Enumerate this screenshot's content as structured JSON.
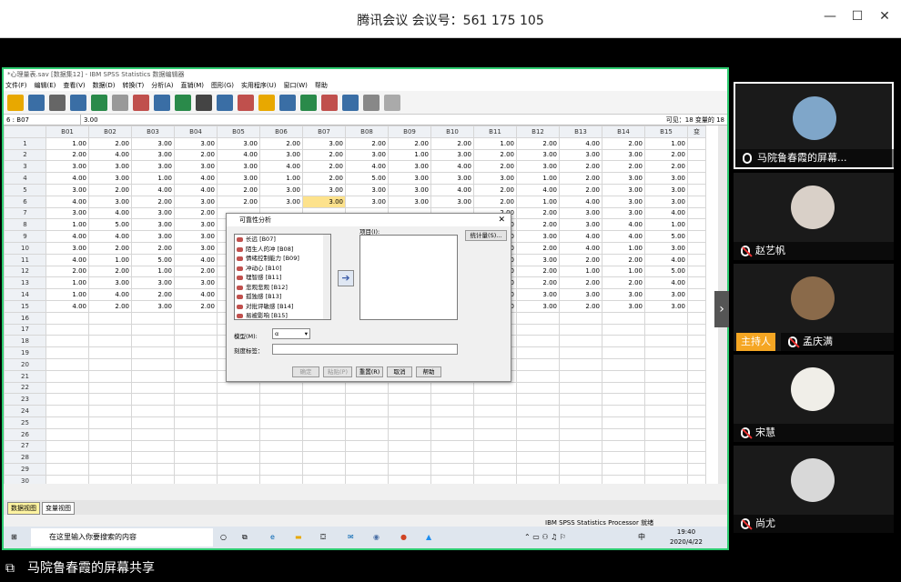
{
  "meeting": {
    "title": "腾讯会议 会议号：561 175 105"
  },
  "spss": {
    "title": "*心理量表.sav [数据集12] - IBM SPSS Statistics 数据编辑器",
    "menu": [
      "文件(F)",
      "编辑(E)",
      "查看(V)",
      "数据(D)",
      "转换(T)",
      "分析(A)",
      "直销(M)",
      "图形(G)",
      "实用程序(U)",
      "窗口(W)",
      "帮助"
    ],
    "cell_ref": "6 : B07",
    "cell_value": "3.00",
    "visible_label": "可见：18 变量的 18",
    "columns": [
      "B01",
      "B02",
      "B03",
      "B04",
      "B05",
      "B06",
      "B07",
      "B08",
      "B09",
      "B10",
      "B11",
      "B12",
      "B13",
      "B14",
      "B15",
      "变"
    ],
    "rows": [
      [
        "1.00",
        "2.00",
        "3.00",
        "3.00",
        "3.00",
        "2.00",
        "3.00",
        "2.00",
        "2.00",
        "2.00",
        "1.00",
        "2.00",
        "4.00",
        "2.00",
        "1.00"
      ],
      [
        "2.00",
        "4.00",
        "3.00",
        "2.00",
        "4.00",
        "3.00",
        "2.00",
        "3.00",
        "1.00",
        "3.00",
        "2.00",
        "3.00",
        "3.00",
        "3.00",
        "2.00"
      ],
      [
        "3.00",
        "3.00",
        "3.00",
        "3.00",
        "3.00",
        "4.00",
        "2.00",
        "4.00",
        "3.00",
        "4.00",
        "2.00",
        "3.00",
        "2.00",
        "2.00",
        "2.00"
      ],
      [
        "4.00",
        "3.00",
        "1.00",
        "4.00",
        "3.00",
        "1.00",
        "2.00",
        "5.00",
        "3.00",
        "3.00",
        "3.00",
        "1.00",
        "2.00",
        "3.00",
        "3.00"
      ],
      [
        "3.00",
        "2.00",
        "4.00",
        "4.00",
        "2.00",
        "3.00",
        "3.00",
        "3.00",
        "3.00",
        "4.00",
        "2.00",
        "4.00",
        "2.00",
        "3.00",
        "3.00"
      ],
      [
        "4.00",
        "3.00",
        "2.00",
        "3.00",
        "2.00",
        "3.00",
        "3.00",
        "3.00",
        "3.00",
        "3.00",
        "2.00",
        "1.00",
        "4.00",
        "3.00",
        "3.00"
      ],
      [
        "3.00",
        "4.00",
        "3.00",
        "2.00",
        "",
        "",
        "",
        "",
        "",
        "",
        "2.00",
        "2.00",
        "3.00",
        "3.00",
        "4.00"
      ],
      [
        "1.00",
        "5.00",
        "3.00",
        "3.00",
        "",
        "",
        "",
        "",
        "",
        "",
        "2.00",
        "2.00",
        "3.00",
        "4.00",
        "1.00"
      ],
      [
        "4.00",
        "4.00",
        "3.00",
        "3.00",
        "",
        "",
        "",
        "",
        "",
        "",
        "2.00",
        "3.00",
        "4.00",
        "4.00",
        "5.00"
      ],
      [
        "3.00",
        "2.00",
        "2.00",
        "3.00",
        "",
        "",
        "",
        "",
        "",
        "",
        "2.00",
        "2.00",
        "4.00",
        "1.00",
        "3.00"
      ],
      [
        "4.00",
        "1.00",
        "5.00",
        "4.00",
        "",
        "",
        "",
        "",
        "",
        "",
        "2.00",
        "3.00",
        "2.00",
        "2.00",
        "4.00"
      ],
      [
        "2.00",
        "2.00",
        "1.00",
        "2.00",
        "",
        "",
        "",
        "",
        "",
        "",
        "2.00",
        "2.00",
        "1.00",
        "1.00",
        "5.00"
      ],
      [
        "1.00",
        "3.00",
        "3.00",
        "3.00",
        "",
        "",
        "",
        "",
        "",
        "",
        "2.00",
        "2.00",
        "2.00",
        "2.00",
        "4.00"
      ],
      [
        "1.00",
        "4.00",
        "2.00",
        "4.00",
        "",
        "",
        "",
        "",
        "",
        "",
        "2.00",
        "3.00",
        "3.00",
        "3.00",
        "3.00"
      ],
      [
        "4.00",
        "2.00",
        "3.00",
        "2.00",
        "",
        "",
        "",
        "",
        "",
        "",
        "2.00",
        "3.00",
        "2.00",
        "3.00",
        "3.00"
      ]
    ],
    "row_numbers": [
      "1",
      "2",
      "3",
      "4",
      "5",
      "6",
      "7",
      "8",
      "9",
      "10",
      "11",
      "12",
      "13",
      "14",
      "15",
      "16",
      "17",
      "18",
      "19",
      "20",
      "21",
      "22",
      "23",
      "24",
      "25",
      "26",
      "27",
      "28",
      "29",
      "30"
    ],
    "view_tabs": [
      "数据视图",
      "变量视图"
    ],
    "status": "IBM SPSS Statistics Processor 就绪",
    "taskbar_search": "在这里输入你要搜索的内容",
    "clock_time": "19:40",
    "clock_date": "2020/4/22",
    "ime": "中"
  },
  "dialog": {
    "title": "可靠性分析",
    "items_label": "项目(I):",
    "stats_button": "统计量(S)...",
    "variables": [
      "长远 [B07]",
      "陌生人的冲 [B08]",
      "情绪控制能力 [B09]",
      "冲动心 [B10]",
      "理智感 [B11]",
      "悲观悲观 [B12]",
      "孤独感 [B13]",
      "对批评敏感 [B14]",
      "易被影响 [B15]"
    ],
    "model_label": "模型(M):",
    "model_value": "α",
    "scale_label": "刻度标签：",
    "buttons": [
      "确定",
      "粘贴(P)",
      "重置(R)",
      "取消",
      "帮助"
    ]
  },
  "participants": [
    {
      "name": "马院鲁春霞的屏幕...",
      "active": true,
      "color": "#7fa6c9"
    },
    {
      "name": "赵艺帆",
      "active": false,
      "color": "#d9d0c8"
    },
    {
      "name": "孟庆满",
      "active": false,
      "color": "#8a6a4a",
      "host_label": "主持人"
    },
    {
      "name": "宋慧",
      "active": false,
      "color": "#f0eee8"
    },
    {
      "name": "尚尤",
      "active": false,
      "color": "#d8d8d8"
    }
  ],
  "bottom_label": "马院鲁春霞的屏幕共享"
}
